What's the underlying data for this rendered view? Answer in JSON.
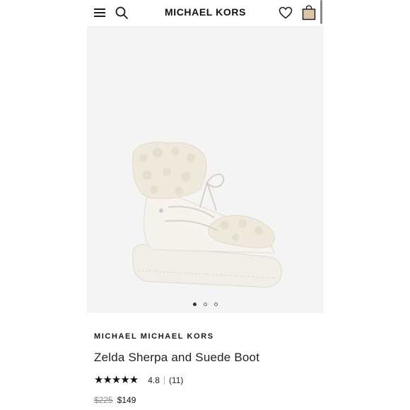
{
  "header": {
    "brand": "MICHAEL KORS",
    "menu_icon": "hamburger-menu-icon",
    "search_icon": "search-icon",
    "wishlist_icon": "heart-icon",
    "bag_icon": "shopping-bag-icon"
  },
  "gallery": {
    "image": "white sherpa lace-up snow boot",
    "slide_count": 3,
    "active_slide": 1
  },
  "product": {
    "brand": "MICHAEL MICHAEL KORS",
    "name": "Zelda Sherpa and Suede Boot",
    "stars": "★★★★★",
    "rating": "4.8",
    "review_count": "(11)",
    "original_price": "$225",
    "sale_price": "$149"
  },
  "colors": {
    "text": "#1a1a1a",
    "image_background": "#f4f4f4",
    "bag_fill": "#d9c7a8"
  }
}
